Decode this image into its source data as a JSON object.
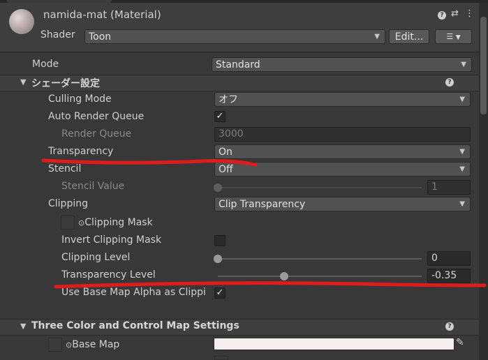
{
  "header": {
    "title": "namida-mat (Material)",
    "shader_label": "Shader",
    "shader_value": "Toon",
    "edit_button": "Edit...",
    "help_icon": "?",
    "settings_icon": "⇄",
    "menu_icon": "⋮",
    "list_icon": "☰"
  },
  "mode": {
    "label": "Mode",
    "value": "Standard"
  },
  "shader_settings": {
    "title": "シェーダー設定",
    "rows": {
      "culling": {
        "label": "Culling Mode",
        "value": "オフ"
      },
      "auto_rq": {
        "label": "Auto Render Queue",
        "checked": true
      },
      "render_queue": {
        "label": "Render Queue",
        "value": "3000"
      },
      "transparency": {
        "label": "Transparency",
        "value": "On"
      },
      "stencil": {
        "label": "Stencil",
        "value": "Off"
      },
      "stencil_value": {
        "label": "Stencil Value",
        "value": "1",
        "fraction": 0.0
      },
      "clipping": {
        "label": "Clipping",
        "value": "Clip Transparency"
      },
      "clipping_mask": {
        "label": "Clipping Mask",
        "prefix": "⊙"
      },
      "invert_mask": {
        "label": "Invert Clipping Mask",
        "checked": false
      },
      "clipping_level": {
        "label": "Clipping Level",
        "value": "0",
        "fraction": 0.0
      },
      "transparency_level": {
        "label": "Transparency Level",
        "value": "-0.35",
        "fraction": 0.325
      },
      "base_alpha": {
        "label": "Use Base Map Alpha as Clippi",
        "checked": true
      }
    }
  },
  "three_color": {
    "title": "Three Color and Control Map Settings",
    "base_map": {
      "label": "Base Map",
      "prefix": "⊙"
    },
    "base_color": "#f6eeee"
  },
  "annotations": {
    "stroke_color": "#e01b1b"
  },
  "colors": {
    "background": "#383838",
    "text": "#d2d2d2",
    "field": "#2a2a2a",
    "dropdown": "#515151"
  }
}
